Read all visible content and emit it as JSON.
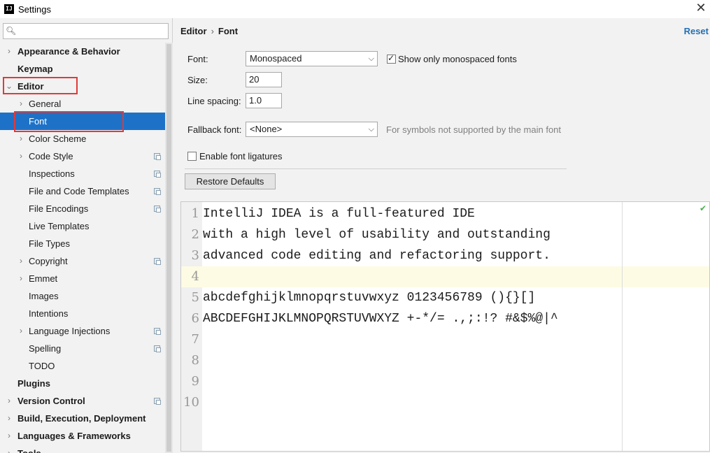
{
  "window": {
    "app_logo": "IJ",
    "title": "Settings",
    "close_glyph": "✕"
  },
  "sidebar": {
    "search_placeholder": "",
    "items": [
      {
        "label": "Appearance & Behavior",
        "bold": true,
        "arrow": "›",
        "indent": 0
      },
      {
        "label": "Keymap",
        "bold": true,
        "arrow": "",
        "indent": 0
      },
      {
        "label": "Editor",
        "bold": true,
        "arrow": "⌄",
        "indent": 0
      },
      {
        "label": "General",
        "arrow": "›",
        "indent": 1
      },
      {
        "label": "Font",
        "arrow": "",
        "indent": 1,
        "selected": true
      },
      {
        "label": "Color Scheme",
        "arrow": "›",
        "indent": 1
      },
      {
        "label": "Code Style",
        "arrow": "›",
        "indent": 1,
        "copy": true
      },
      {
        "label": "Inspections",
        "arrow": "",
        "indent": 1,
        "copy": true
      },
      {
        "label": "File and Code Templates",
        "arrow": "",
        "indent": 1,
        "copy": true
      },
      {
        "label": "File Encodings",
        "arrow": "",
        "indent": 1,
        "copy": true
      },
      {
        "label": "Live Templates",
        "arrow": "",
        "indent": 1
      },
      {
        "label": "File Types",
        "arrow": "",
        "indent": 1
      },
      {
        "label": "Copyright",
        "arrow": "›",
        "indent": 1,
        "copy": true
      },
      {
        "label": "Emmet",
        "arrow": "›",
        "indent": 1
      },
      {
        "label": "Images",
        "arrow": "",
        "indent": 1
      },
      {
        "label": "Intentions",
        "arrow": "",
        "indent": 1
      },
      {
        "label": "Language Injections",
        "arrow": "›",
        "indent": 1,
        "copy": true
      },
      {
        "label": "Spelling",
        "arrow": "",
        "indent": 1,
        "copy": true
      },
      {
        "label": "TODO",
        "arrow": "",
        "indent": 1
      },
      {
        "label": "Plugins",
        "bold": true,
        "arrow": "",
        "indent": 0
      },
      {
        "label": "Version Control",
        "bold": true,
        "arrow": "›",
        "indent": 0,
        "copy": true
      },
      {
        "label": "Build, Execution, Deployment",
        "bold": true,
        "arrow": "›",
        "indent": 0
      },
      {
        "label": "Languages & Frameworks",
        "bold": true,
        "arrow": "›",
        "indent": 0
      },
      {
        "label": "Tools",
        "bold": true,
        "arrow": "›",
        "indent": 0
      }
    ]
  },
  "main": {
    "breadcrumb": {
      "parent": "Editor",
      "separator": "›",
      "current": "Font"
    },
    "reset_label": "Reset",
    "font": {
      "label": "Font:",
      "value": "Monospaced"
    },
    "monospaced_only": {
      "label": "Show only monospaced fonts",
      "checked": true
    },
    "size": {
      "label": "Size:",
      "value": "20"
    },
    "line_spacing": {
      "label": "Line spacing:",
      "value": "1.0"
    },
    "fallback": {
      "label": "Fallback font:",
      "value": "<None>",
      "hint": "For symbols not supported by the main font"
    },
    "ligatures": {
      "label": "Enable font ligatures",
      "checked": false
    },
    "restore_defaults_label": "Restore Defaults"
  },
  "preview": {
    "lines": [
      {
        "no": "1",
        "text": "IntelliJ IDEA is a full-featured IDE"
      },
      {
        "no": "2",
        "text": "with a high level of usability and outstanding"
      },
      {
        "no": "3",
        "text": "advanced code editing and refactoring support."
      },
      {
        "no": "4",
        "text": "",
        "current": true
      },
      {
        "no": "5",
        "text": "abcdefghijklmnopqrstuvwxyz 0123456789 (){}[]"
      },
      {
        "no": "6",
        "text": "ABCDEFGHIJKLMNOPQRSTUVWXYZ +-*/= .,;:!? #&$%@|^"
      },
      {
        "no": "7",
        "text": ""
      },
      {
        "no": "8",
        "text": ""
      },
      {
        "no": "9",
        "text": ""
      },
      {
        "no": "10",
        "text": ""
      }
    ],
    "status_glyph": "✔"
  }
}
